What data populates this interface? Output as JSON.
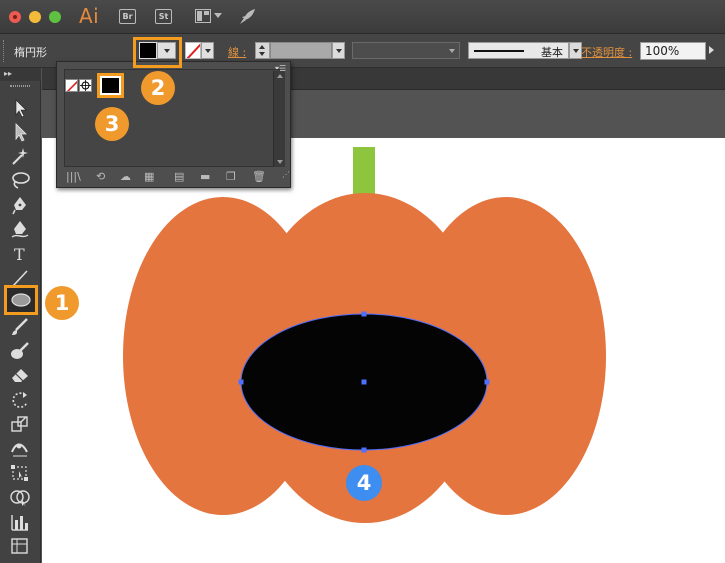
{
  "app": {
    "logo": "Ai",
    "bridge_label": "Br",
    "stock_label": "St"
  },
  "control_bar": {
    "tool_name": "楕円形",
    "stroke_label": "線 :",
    "brush_label": "基本",
    "opacity_label": "不透明度 :",
    "opacity_value": "100%"
  },
  "swatch_panel": {
    "swatches": [
      "none",
      "registration",
      "black"
    ],
    "selected": "black"
  },
  "callouts": [
    "1",
    "2",
    "3",
    "4"
  ],
  "colors": {
    "pumpkin": "#E4753F",
    "stem": "#8DC53F",
    "ellipse_fill": "#050404",
    "selection": "#4F6FFF",
    "highlight": "#F39C1F",
    "badge_orange": "#F09A2D",
    "badge_blue": "#3D8EF0"
  }
}
